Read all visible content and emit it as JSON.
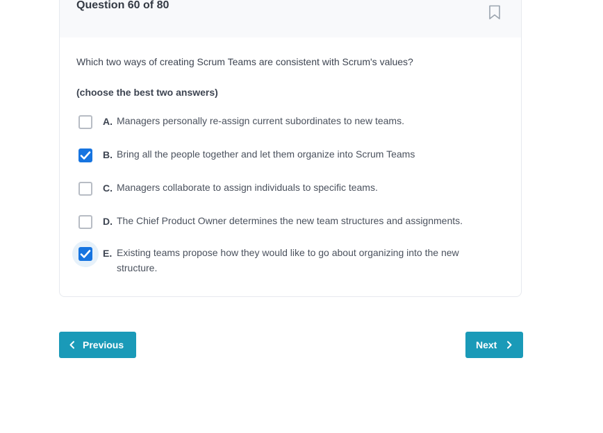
{
  "question": {
    "title": "Question 60 of 80",
    "text": "Which two ways of creating Scrum Teams are consistent with Scrum's values?",
    "instruction": "(choose the best two answers)"
  },
  "options": [
    {
      "letter": "A.",
      "text": "Managers personally re-assign current subordinates to new teams.",
      "checked": false
    },
    {
      "letter": "B.",
      "text": "Bring all the people together and let them organize into Scrum Teams",
      "checked": true
    },
    {
      "letter": "C.",
      "text": "Managers collaborate to assign individuals to specific teams.",
      "checked": false
    },
    {
      "letter": "D.",
      "text": "The Chief Product Owner determines the new team structures and assignments.",
      "checked": false
    },
    {
      "letter": "E.",
      "text": "Existing teams propose how they would like to go about organizing into the new structure.",
      "checked": true
    }
  ],
  "nav": {
    "previous_label": "Previous",
    "next_label": "Next"
  },
  "colors": {
    "accent": "#1a9ab8",
    "checkbox_checked": "#1674e0"
  },
  "icons": {
    "bookmark": "bookmark-icon",
    "checkmark": "checkmark-icon",
    "previous": "chevron-left-icon",
    "next": "chevron-right-icon"
  }
}
